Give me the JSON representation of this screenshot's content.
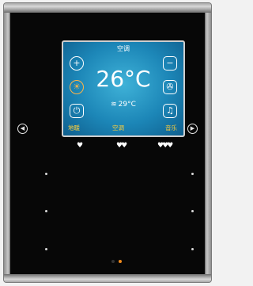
{
  "lcd": {
    "title": "空调",
    "set_temperature": "26°C",
    "room_temperature": "29°C",
    "room_icon": "thermometer-wave-icon",
    "left_buttons": [
      "plus-icon",
      "sun-icon",
      "power-icon"
    ],
    "right_buttons": [
      "minus-icon",
      "fan-icon",
      "music-icon"
    ],
    "bottom_labels": [
      "地暖",
      "空调",
      "音乐"
    ]
  },
  "side_controls": [
    "previous-arrow-icon",
    "next-arrow-icon"
  ],
  "scene_marks": [
    "♥",
    "♥♥",
    "♥♥♥"
  ],
  "indicator_colors": [
    "#333333",
    "#f08a1c"
  ],
  "colors": {
    "lcd_blue": "#1c86b7",
    "lcd_orange": "#ffcf3a",
    "glass": "#070707"
  }
}
